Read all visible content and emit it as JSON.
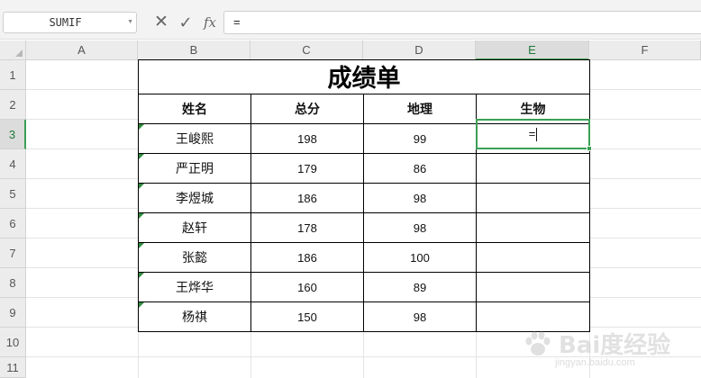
{
  "formula_bar": {
    "name_box": "SUMIF",
    "cancel_icon": "close-icon",
    "confirm_icon": "check-icon",
    "function_icon": "fx-icon",
    "formula_value": "="
  },
  "columns": [
    "A",
    "B",
    "C",
    "D",
    "E",
    "F"
  ],
  "rows": [
    "1",
    "2",
    "3",
    "4",
    "5",
    "6",
    "7",
    "8",
    "9",
    "10",
    "11"
  ],
  "selected": {
    "column": "E",
    "row": "3"
  },
  "sheet": {
    "title": "成绩单",
    "headers": [
      "姓名",
      "总分",
      "地理",
      "生物"
    ],
    "records": [
      {
        "name": "王峻熙",
        "total": "198",
        "geo": "99",
        "bio": ""
      },
      {
        "name": "严正明",
        "total": "179",
        "geo": "86",
        "bio": ""
      },
      {
        "name": "李煜城",
        "total": "186",
        "geo": "98",
        "bio": ""
      },
      {
        "name": "赵轩",
        "total": "178",
        "geo": "98",
        "bio": ""
      },
      {
        "name": "张懿",
        "total": "186",
        "geo": "100",
        "bio": ""
      },
      {
        "name": "王烨华",
        "total": "160",
        "geo": "89",
        "bio": ""
      },
      {
        "name": "杨祺",
        "total": "150",
        "geo": "98",
        "bio": ""
      }
    ],
    "active_cell_value": "="
  },
  "watermark": {
    "text": "Bai度经验",
    "url": "jingyan.baidu.com"
  },
  "colors": {
    "selection": "#3c9f55",
    "header_bg": "#ececec",
    "grid_line": "#e4e4e4"
  }
}
